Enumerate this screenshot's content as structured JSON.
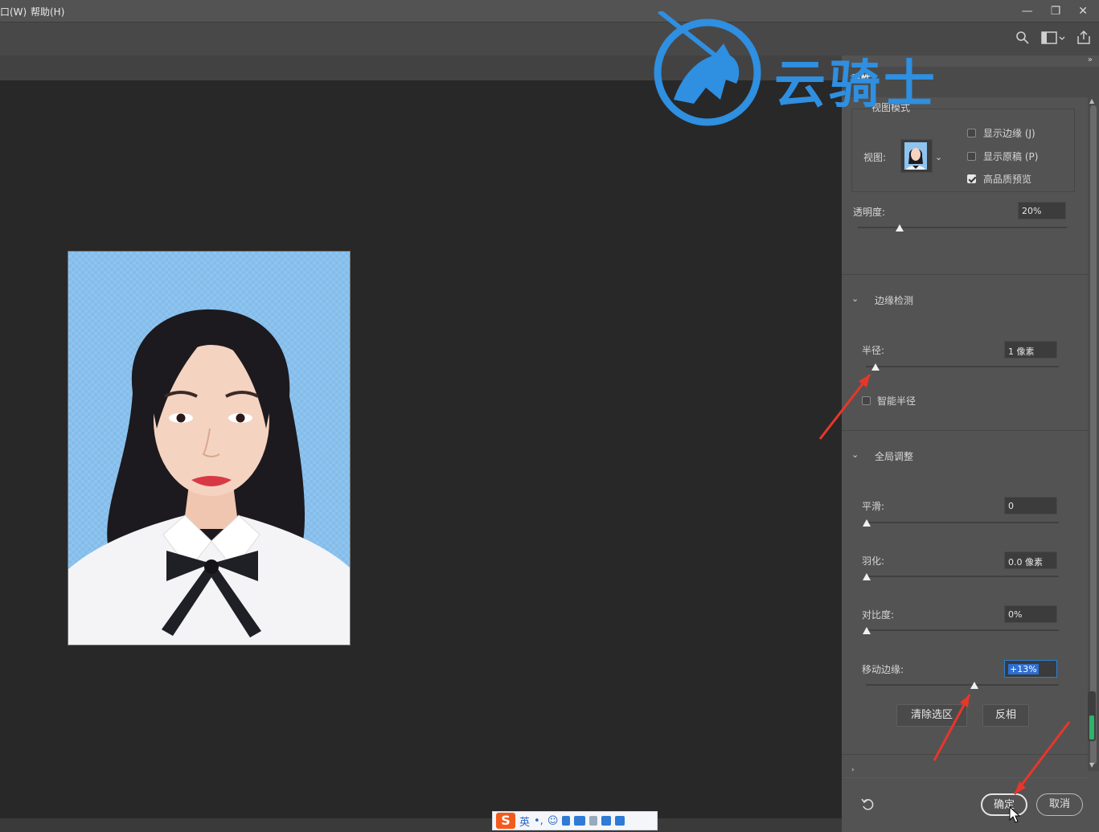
{
  "menubar": {
    "items": [
      "口(W)",
      "帮助(H)"
    ],
    "window_controls": [
      "minimize",
      "restore",
      "close"
    ]
  },
  "options_bar": {
    "icons": [
      "search-icon",
      "workspace-icon",
      "share-icon"
    ]
  },
  "watermark": {
    "text": "云骑士"
  },
  "panel": {
    "title": "属性",
    "view_mode": {
      "heading": "视图模式",
      "view_label": "视图:",
      "show_edge": "显示边缘 (J)",
      "show_original": "显示原稿 (P)",
      "high_quality": "高品质预览",
      "show_edge_checked": false,
      "show_original_checked": false,
      "high_quality_checked": true
    },
    "opacity": {
      "label": "透明度:",
      "value": "20%",
      "level": 0.2
    },
    "edge_detection": {
      "heading": "边缘检测",
      "radius_label": "半径:",
      "radius_value": "1 像素",
      "radius_level": 0.04,
      "smart_radius": "智能半径",
      "smart_radius_checked": false
    },
    "global_refine": {
      "heading": "全局调整",
      "smooth_label": "平滑:",
      "smooth_value": "0",
      "feather_label": "羽化:",
      "feather_value": "0.0 像素",
      "contrast_label": "对比度:",
      "contrast_value": "0%",
      "shift_edge_label": "移动边缘:",
      "shift_edge_value": "+13%",
      "shift_edge_level": 0.565,
      "clear_selection": "清除选区",
      "invert": "反相"
    },
    "footer": {
      "ok": "确定",
      "cancel": "取消"
    }
  },
  "ime": {
    "logo": "S",
    "mode": "英"
  },
  "colors": {
    "panel_bg": "#535353",
    "canvas_bg": "#282828",
    "accent_blue": "#2f8fe0",
    "photo_bg": "#8ec4ee",
    "arrow_red": "#e8362b"
  }
}
